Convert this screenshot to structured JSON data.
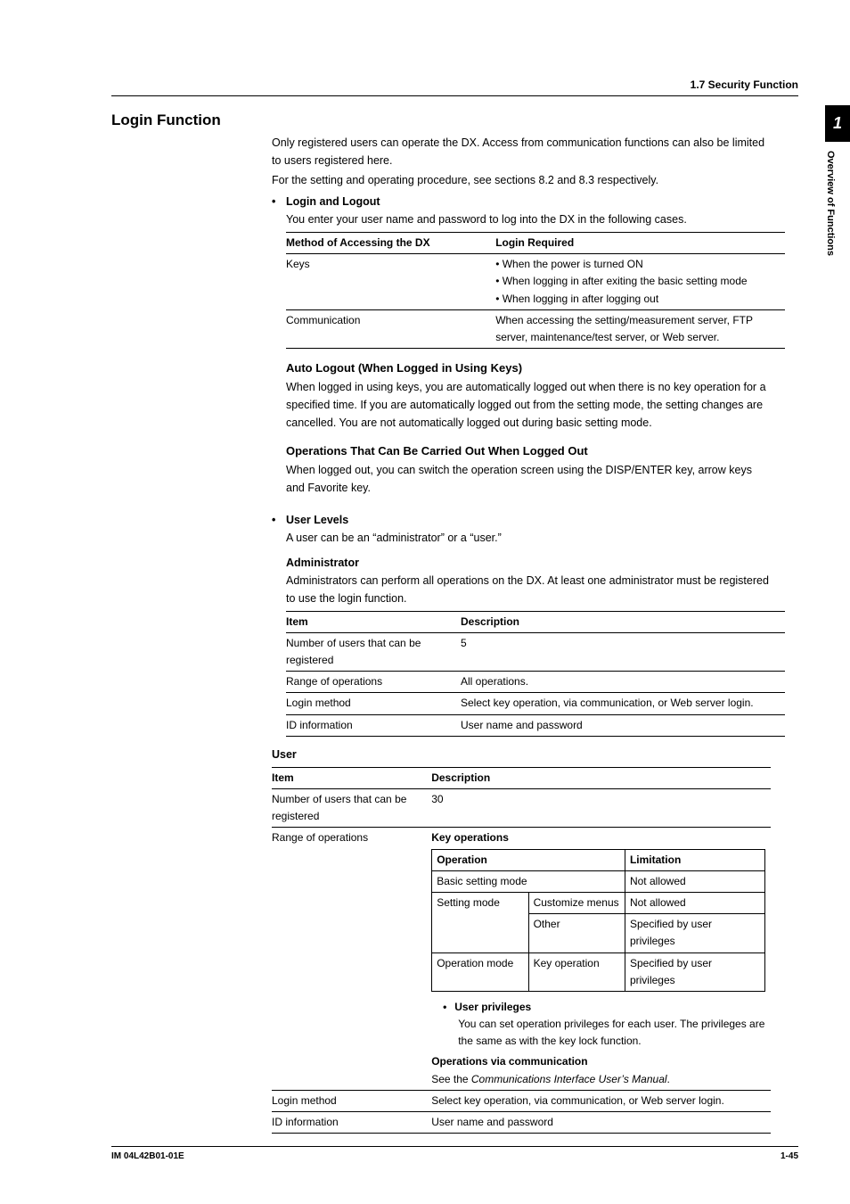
{
  "section_header": "1.7  Security Function",
  "side_tab": {
    "num": "1",
    "label": "Overview of Functions"
  },
  "h_login": "Login Function",
  "intro": {
    "p1": "Only registered users can operate the DX. Access from communication functions can also be limited to users registered here.",
    "p2": "For the setting and operating procedure, see sections 8.2 and 8.3 respectively."
  },
  "login_logout": {
    "title": "Login and Logout",
    "desc": "You enter your user name and password to log into the DX in the following cases.",
    "table": {
      "head": [
        "Method of Accessing the DX",
        "Login Required"
      ],
      "rows": [
        {
          "c0": "Keys",
          "c1": [
            "When the power is turned ON",
            "When logging in after exiting the basic setting mode",
            "When logging in after logging out"
          ]
        },
        {
          "c0": "Communication",
          "c1_plain": "When accessing the setting/measurement server, FTP server, maintenance/test server, or Web server."
        }
      ]
    }
  },
  "auto_logout": {
    "title": "Auto Logout (When Logged in Using Keys)",
    "body": "When logged in using keys, you are automatically logged out when there is no key operation for a specified time. If you are automatically logged out from the setting mode, the setting changes are cancelled. You are not automatically logged out during basic setting mode."
  },
  "logged_out": {
    "title": "Operations That Can Be Carried Out When Logged Out",
    "body": "When logged out, you can switch the operation screen using the DISP/ENTER key, arrow keys and Favorite key."
  },
  "user_levels": {
    "title": "User Levels",
    "desc": "A user can be an “administrator” or a “user.”"
  },
  "admin": {
    "title": "Administrator",
    "desc": "Administrators can perform all operations on the DX. At least one administrator must be registered to use the login function.",
    "head": [
      "Item",
      "Description"
    ],
    "rows": [
      [
        "Number of users that can be registered",
        "5"
      ],
      [
        "Range of operations",
        "All operations."
      ],
      [
        "Login method",
        "Select key operation, via communication, or Web server login."
      ],
      [
        "ID information",
        "User name and password"
      ]
    ]
  },
  "user": {
    "title": "User",
    "head": [
      "Item",
      "Description"
    ],
    "row_num": [
      "Number of users that can be registered",
      "30"
    ],
    "row_range_label": "Range of operations",
    "key_ops_label": "Key operations",
    "inner_head": [
      "Operation",
      "",
      "Limitation"
    ],
    "inner_rows": [
      [
        "Basic setting mode",
        "",
        "Not allowed"
      ],
      [
        "Setting mode",
        "Customize menus",
        "Not allowed"
      ],
      [
        "",
        "Other",
        "Specified by user privileges"
      ],
      [
        "Operation mode",
        "Key operation",
        "Specified by user privileges"
      ]
    ],
    "priv_title": "User privileges",
    "priv_body": "You can set operation privileges for each user. The privileges are the same as with the key lock function.",
    "ops_comm_title": "Operations via communication",
    "ops_comm_body_prefix": "See the ",
    "ops_comm_body_italic": "Communications Interface User’s Manual",
    "ops_comm_body_suffix": ".",
    "row_login": [
      "Login method",
      "Select key operation, via communication, or Web server login."
    ],
    "row_id": [
      "ID information",
      "User name and password"
    ]
  },
  "footer": {
    "left": "IM 04L42B01-01E",
    "right": "1-45"
  }
}
